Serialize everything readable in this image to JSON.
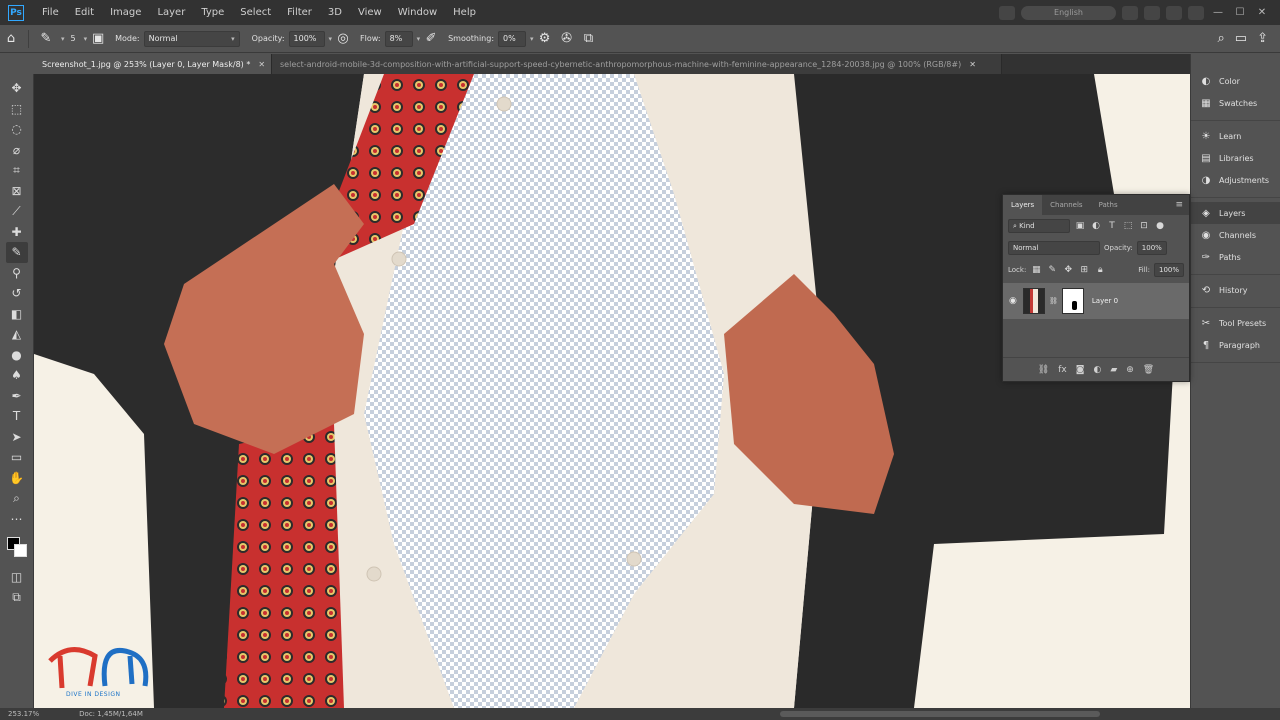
{
  "menubar": {
    "items": [
      "File",
      "Edit",
      "Image",
      "Layer",
      "Type",
      "Select",
      "Filter",
      "3D",
      "View",
      "Window",
      "Help"
    ],
    "search_text": "English"
  },
  "options": {
    "brush_size": "5",
    "mode_label": "Mode:",
    "mode_value": "Normal",
    "opacity_label": "Opacity:",
    "opacity_value": "100%",
    "flow_label": "Flow:",
    "flow_value": "8%",
    "smoothing_label": "Smoothing:",
    "smoothing_value": "0%"
  },
  "tabs": [
    {
      "label": "Screenshot_1.jpg @ 253% (Layer 0, Layer Mask/8) *"
    },
    {
      "label": "select-android-mobile-3d-composition-with-artificial-support-speed-cybernetic-anthropomorphous-machine-with-feminine-appearance_1284-20038.jpg @ 100% (RGB/8#)"
    }
  ],
  "dock": {
    "group1": [
      "Color",
      "Swatches"
    ],
    "group2": [
      "Learn",
      "Libraries",
      "Adjustments"
    ],
    "group3": [
      "Layers",
      "Channels",
      "Paths"
    ],
    "group4": [
      "History"
    ],
    "group5": [
      "Tool Presets",
      "Paragraph"
    ]
  },
  "layers_panel": {
    "tabs": [
      "Layers",
      "Channels",
      "Paths"
    ],
    "filter_value": "Kind",
    "blend_mode": "Normal",
    "opacity_label": "Opacity:",
    "opacity_value": "100%",
    "lock_label": "Lock:",
    "fill_label": "Fill:",
    "fill_value": "100%",
    "layer_name": "Layer 0"
  },
  "watermark": {
    "text": "DIVE IN DESIGN"
  },
  "status": {
    "zoom": "253.17%",
    "doc": "Doc: 1,45M/1,64M"
  },
  "colors": {
    "accent": "#31a8ff",
    "canvas_bg": "#f6f1e6",
    "tie_red": "#c8302f",
    "suit": "#2b2b2b"
  }
}
